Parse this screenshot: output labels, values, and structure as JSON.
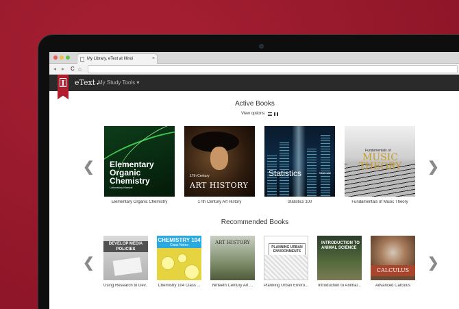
{
  "browser": {
    "tab_title": "My Library, eText at Illinoi",
    "tab_close": "×",
    "nav_back": "◂",
    "nav_forward": "▸",
    "nav_reload": "C",
    "nav_home": "⌂"
  },
  "header": {
    "logo_letter": "I",
    "brand": "eText",
    "brand_caret": "▾",
    "study_tools": "My Study Tools ▾"
  },
  "active": {
    "title": "Active Books",
    "view_options_label": "View options:",
    "prev_arrow": "❮",
    "next_arrow": "❯",
    "books": [
      {
        "label": "Elementary Organic Chemistry",
        "cover_title": "Elementary Organic Chemistry",
        "cover_sub": "Laboratory Manual"
      },
      {
        "label": "17th Century Art History",
        "cover_century": "17th Century",
        "cover_title": "ART HISTORY"
      },
      {
        "label": "Statistics 100",
        "cover_title": "Statistics",
        "cover_code": "STAT 100"
      },
      {
        "label": "Fundamentals of Music Theory",
        "cover_fund": "Fundamentals of",
        "cover_title": "MUSIC THEORY"
      }
    ]
  },
  "recommended": {
    "title": "Recommended Books",
    "prev_arrow": "❮",
    "next_arrow": "❯",
    "books": [
      {
        "label": "Using Research to Dev...",
        "cover_title": "DEVELOP MEDIA POLICIES"
      },
      {
        "label": "Chemistry 104 Class ...",
        "cover_title": "CHEMISTRY 104",
        "cover_sub": "Class Notes"
      },
      {
        "label": "Nirteeth Century Art ...",
        "cover_title": "ART HISTORY"
      },
      {
        "label": "Planning Urban Enviro...",
        "cover_title": "PLANNING URBAN ENVIRONMENTS"
      },
      {
        "label": "Introduction to Animal...",
        "cover_title": "INTRODUCTION TO ANIMAL SCIENCE"
      },
      {
        "label": "Advanced Calculus",
        "cover_title": "CALCULUS"
      }
    ]
  }
}
